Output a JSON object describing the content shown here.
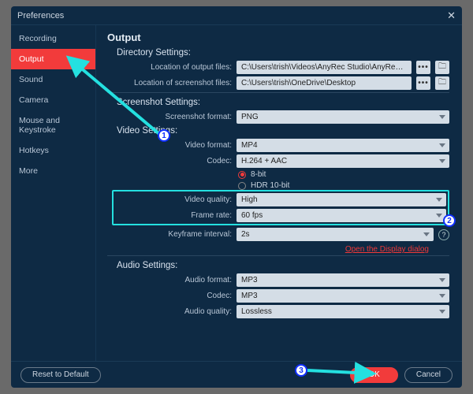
{
  "window": {
    "title": "Preferences"
  },
  "sidebar": {
    "items": [
      {
        "label": "Recording"
      },
      {
        "label": "Output"
      },
      {
        "label": "Sound"
      },
      {
        "label": "Camera"
      },
      {
        "label": "Mouse and Keystroke"
      },
      {
        "label": "Hotkeys"
      },
      {
        "label": "More"
      }
    ],
    "active_index": 1
  },
  "page": {
    "title": "Output",
    "directory": {
      "heading": "Directory Settings:",
      "output_label": "Location of output files:",
      "output_value": "C:\\Users\\trish\\Videos\\AnyRec Studio\\AnyRec Screen Recorder",
      "screenshot_label": "Location of screenshot files:",
      "screenshot_value": "C:\\Users\\trish\\OneDrive\\Desktop"
    },
    "screenshot": {
      "heading": "Screenshot Settings:",
      "format_label": "Screenshot format:",
      "format_value": "PNG"
    },
    "video": {
      "heading": "Video Settings:",
      "format_label": "Video format:",
      "format_value": "MP4",
      "codec_label": "Codec:",
      "codec_value": "H.264 + AAC",
      "bit8": "8-bit",
      "hdr10": "HDR 10-bit",
      "quality_label": "Video quality:",
      "quality_value": "High",
      "framerate_label": "Frame rate:",
      "framerate_value": "60 fps",
      "keyframe_label": "Keyframe interval:",
      "keyframe_value": "2s",
      "display_link": "Open the Display dialog"
    },
    "audio": {
      "heading": "Audio Settings:",
      "format_label": "Audio format:",
      "format_value": "MP3",
      "codec_label": "Codec:",
      "codec_value": "MP3",
      "quality_label": "Audio quality:",
      "quality_value": "Lossless"
    }
  },
  "footer": {
    "reset": "Reset to Default",
    "ok": "OK",
    "cancel": "Cancel"
  },
  "annotations": {
    "n1": "1",
    "n2": "2",
    "n3": "3"
  }
}
